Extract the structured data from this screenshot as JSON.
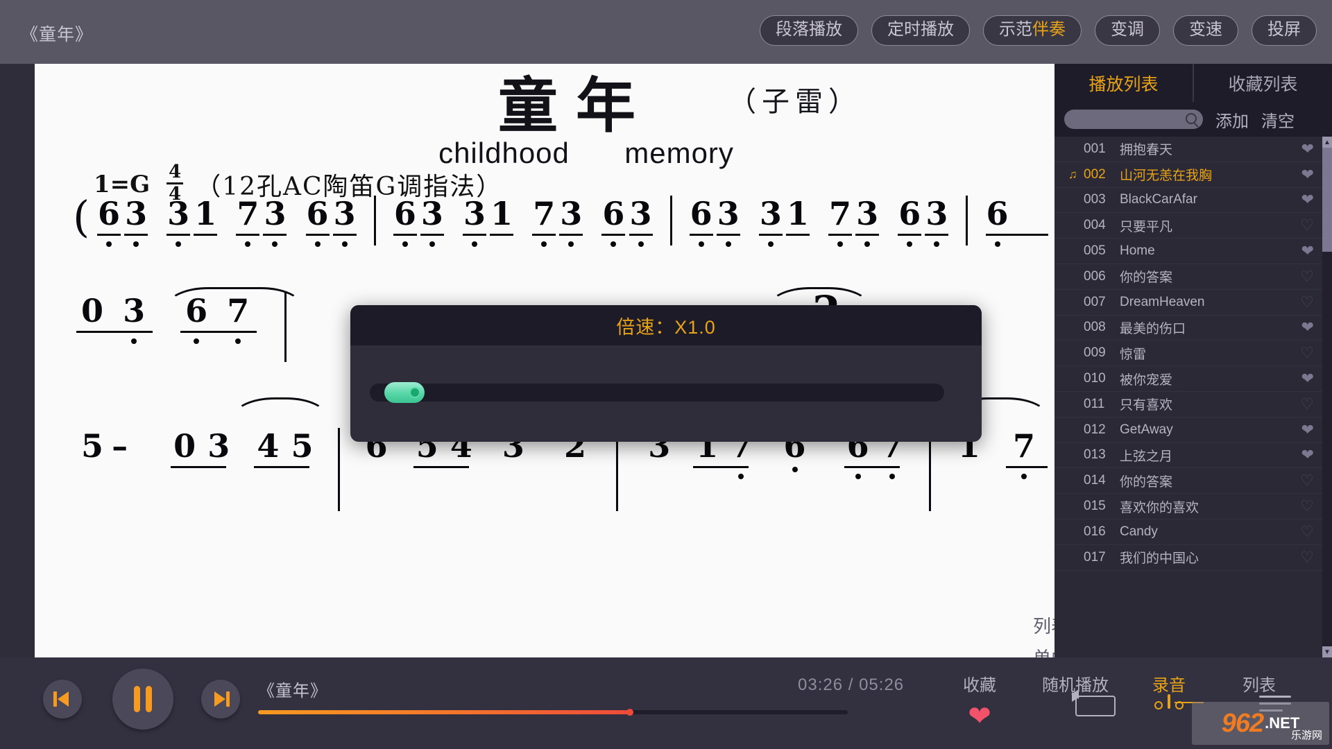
{
  "topbar": {
    "window_title": "《童年》",
    "buttons": [
      {
        "label": "段落播放",
        "name": "section-play-button"
      },
      {
        "label": "定时播放",
        "name": "timed-play-button"
      },
      {
        "label": "示范",
        "label_hl": "伴奏",
        "name": "demo-accompaniment-button"
      },
      {
        "label": "变调",
        "name": "transpose-button"
      },
      {
        "label": "变速",
        "name": "speed-button"
      },
      {
        "label": "投屏",
        "name": "cast-button"
      }
    ]
  },
  "score": {
    "title": "童年",
    "author": "（子雷）",
    "subtitle_left": "childhood",
    "subtitle_right": "memory",
    "key_prefix": "1=G",
    "meter_num": "4",
    "meter_den": "4",
    "instrument_note": "（12孔AC陶笛G调指法）"
  },
  "jianpu": {
    "line1": "( 6̣3̣ 3̣1 7̣3̣ 6̣3̣ | 6̣3̣ 3̣1 7̣3̣ 6̣3̣ | 6̣3̣ 3̣1 7̣3̣ 6̣3̣ | 6̣",
    "line2": "0 3̣  6̣ 7̣        2",
    "line3": "5 –  0 3  4 5 | 6  5 4  3  2 | 3  1 7̣  6̣ ∨ 6̣7̣ | 1  7"
  },
  "speed_dialog": {
    "title": "倍速：X1.0",
    "slider_value_pct": 3
  },
  "playlist": {
    "tabs": [
      {
        "label": "播放列表",
        "active": true,
        "name": "tab-playlist"
      },
      {
        "label": "收藏列表",
        "active": false,
        "name": "tab-favorites"
      }
    ],
    "search_placeholder": "",
    "search_value": "",
    "add_label": "添加",
    "clear_label": "清空",
    "items": [
      {
        "index": "001",
        "name": "拥抱春天",
        "fav": true,
        "current": false
      },
      {
        "index": "002",
        "name": "山河无恙在我胸",
        "fav": true,
        "current": true
      },
      {
        "index": "003",
        "name": "BlackCarAfar",
        "fav": true,
        "current": false
      },
      {
        "index": "004",
        "name": "只要平凡",
        "fav": false,
        "current": false
      },
      {
        "index": "005",
        "name": "Home",
        "fav": true,
        "current": false
      },
      {
        "index": "006",
        "name": "你的答案",
        "fav": false,
        "current": false
      },
      {
        "index": "007",
        "name": "DreamHeaven",
        "fav": false,
        "current": false
      },
      {
        "index": "008",
        "name": "最美的伤口",
        "fav": true,
        "current": false
      },
      {
        "index": "009",
        "name": "惊雷",
        "fav": false,
        "current": false
      },
      {
        "index": "010",
        "name": "被你宠爱",
        "fav": true,
        "current": false
      },
      {
        "index": "011",
        "name": "只有喜欢",
        "fav": false,
        "current": false
      },
      {
        "index": "012",
        "name": "GetAway",
        "fav": true,
        "current": false
      },
      {
        "index": "013",
        "name": "上弦之月",
        "fav": true,
        "current": false
      },
      {
        "index": "014",
        "name": "你的答案",
        "fav": false,
        "current": false
      },
      {
        "index": "015",
        "name": "喜欢你的喜欢",
        "fav": false,
        "current": false
      },
      {
        "index": "016",
        "name": "Candy",
        "fav": false,
        "current": false
      },
      {
        "index": "017",
        "name": "我们的中国心",
        "fav": false,
        "current": false
      }
    ]
  },
  "loop_popup": {
    "option1": "列表循环",
    "option2": "单曲循环"
  },
  "player": {
    "track_title": "《童年》",
    "current_time": "03:26",
    "total_time": "05:26",
    "time_separator": "/",
    "progress_pct": 63,
    "buttons": {
      "prev": "prev-track-button",
      "play_pause": "pause-button",
      "next": "next-track-button"
    },
    "actions": [
      {
        "label": "收藏",
        "name": "favorite-button"
      },
      {
        "label": "随机播放",
        "name": "shuffle-button"
      },
      {
        "label": "录音",
        "name": "record-button"
      },
      {
        "label": "列表",
        "name": "playlist-toggle-button"
      }
    ]
  },
  "watermark": {
    "num": "962",
    "dot_net": ".NET",
    "cn": "乐游网"
  },
  "colors": {
    "accent_gold": "#e8a317",
    "accent_orange": "#f79a20",
    "heart_red": "#f2536a",
    "slider_green": "#58d6a8",
    "topbar_bg": "#5a5765",
    "panel_bg": "#2b2935"
  }
}
